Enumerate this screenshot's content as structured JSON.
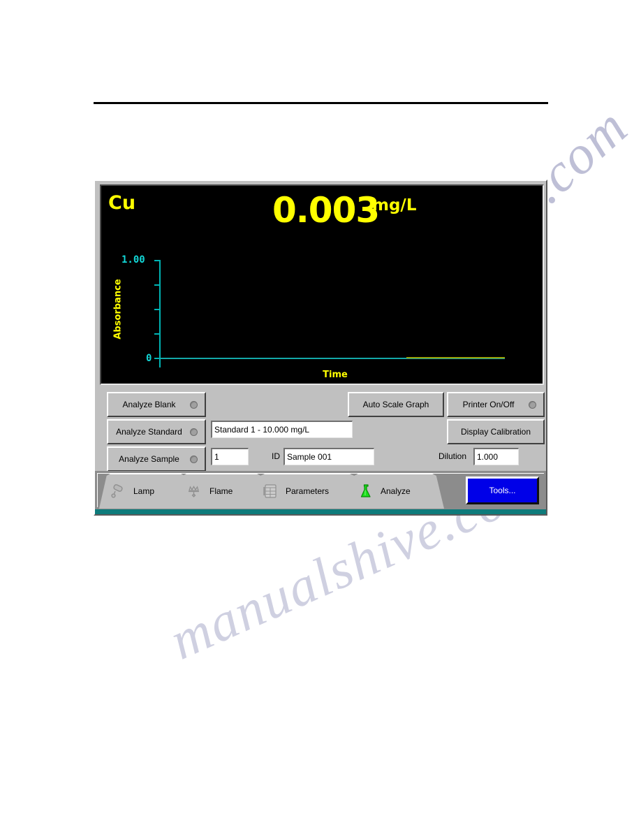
{
  "page": {
    "rule": "horizontal-rule",
    "watermark_text_1": "manualshive.com",
    "watermark_text_2": "manualshive.com"
  },
  "instrument": {
    "graph": {
      "element_symbol": "Cu",
      "reading_value": "0.003",
      "reading_units": "mg/L",
      "y_axis_title": "Absorbance",
      "x_axis_title": "Time",
      "y_tick_top_label": "1.00",
      "y_tick_bottom_label": "0",
      "colors": {
        "screen_background": "#000000",
        "reading": "#ffff00",
        "axis": "#00b3b3",
        "axis_text": "#12d7d7",
        "axis_title": "#ffff00",
        "trace": "#9aa000"
      }
    },
    "chart_data": {
      "type": "line",
      "title": "Cu 0.003 mg/L",
      "xlabel": "Time",
      "ylabel": "Absorbance",
      "ylim": [
        0,
        1.0
      ],
      "y_tick_labels": [
        "1.00",
        "",
        "",
        "",
        "0"
      ],
      "y_tick_values": [
        1.0,
        0.75,
        0.5,
        0.25,
        0
      ],
      "grid": false,
      "legend": "none",
      "series": [
        {
          "name": "Absorbance trace",
          "color": "#9aa000",
          "x": [
            0.715,
            1.0
          ],
          "values": [
            0.003,
            0.003
          ]
        }
      ]
    },
    "controls": {
      "analyze_blank": "Analyze Blank",
      "analyze_standard": "Analyze Standard",
      "analyze_sample": "Analyze Sample",
      "auto_scale_graph": "Auto Scale Graph",
      "printer_on_off": "Printer On/Off",
      "display_calibration": "Display Calibration",
      "standard_value": "Standard 1 - 10.000 mg/L",
      "sample_number_value": "1",
      "id_label": "ID",
      "sample_id_value": "Sample 001",
      "dilution_label": "Dilution",
      "dilution_value": "1.000"
    },
    "tabs": [
      {
        "label": "Lamp",
        "icon": "lamp-icon",
        "active": false
      },
      {
        "label": "Flame",
        "icon": "flame-icon",
        "active": false
      },
      {
        "label": "Parameters",
        "icon": "parameters-icon",
        "active": false
      },
      {
        "label": "Analyze",
        "icon": "flask-icon",
        "active": true
      }
    ],
    "tools_button": "Tools..."
  }
}
